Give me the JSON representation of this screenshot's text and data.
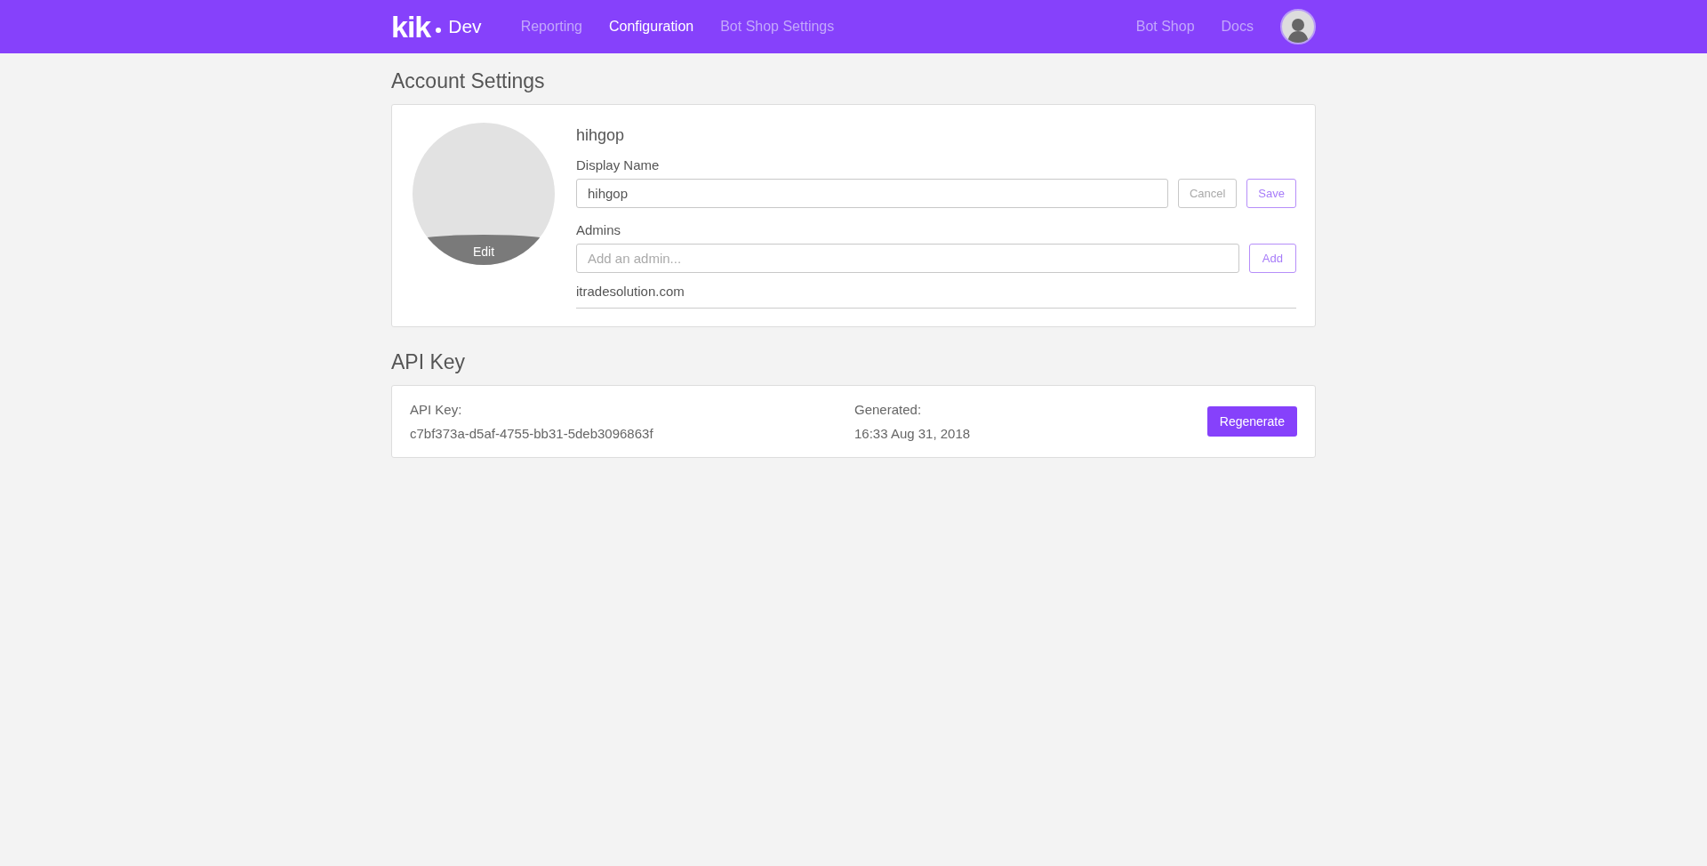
{
  "navbar": {
    "logo": "kik",
    "logo_suffix": "Dev",
    "links": [
      {
        "label": "Reporting",
        "selected": false
      },
      {
        "label": "Configuration",
        "selected": true
      },
      {
        "label": "Bot Shop Settings",
        "selected": false
      }
    ],
    "right_links": [
      {
        "label": "Bot Shop"
      },
      {
        "label": "Docs"
      }
    ]
  },
  "account_settings": {
    "title": "Account Settings",
    "avatar_edit": "Edit",
    "username": "hihgop",
    "display_name": {
      "label": "Display Name",
      "value": "hihgop",
      "buttons": [
        {
          "label": "Cancel",
          "kind": "neutral"
        },
        {
          "label": "Save",
          "kind": "primary"
        }
      ]
    },
    "admins": {
      "label": "Admins",
      "placeholder": "Add an admin...",
      "button": "Add",
      "list": [
        "itradesolution.com"
      ]
    }
  },
  "api_key": {
    "title": "API Key",
    "key_label": "API Key:",
    "key_value": "c7bf373a-d5af-4755-bb31-5deb3096863f",
    "generated_label": "Generated:",
    "generated_value": "16:33 Aug 31, 2018",
    "button": "Regenerate"
  }
}
